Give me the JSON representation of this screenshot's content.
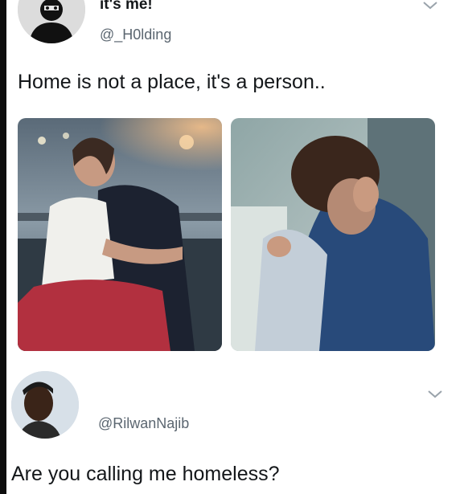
{
  "tweets": [
    {
      "display_name": "it's me!",
      "handle": "@_H0lding",
      "text": "Home is not a place, it's a person..",
      "avatar_icon": "masked-figure-avatar",
      "menu_icon": "chevron-down-icon",
      "media": [
        {
          "icon": "couple-hug-on-train-photo"
        },
        {
          "icon": "couple-embrace-photo"
        }
      ]
    },
    {
      "display_name": "",
      "handle": "@RilwanNajib",
      "text": "Are you calling me homeless?",
      "avatar_icon": "profile-photo-avatar",
      "menu_icon": "chevron-down-icon"
    }
  ],
  "colors": {
    "text": "#14171a",
    "handle": "#5b6670",
    "chevron": "#9aa3ab",
    "left_bar": "#0d0d0d"
  }
}
